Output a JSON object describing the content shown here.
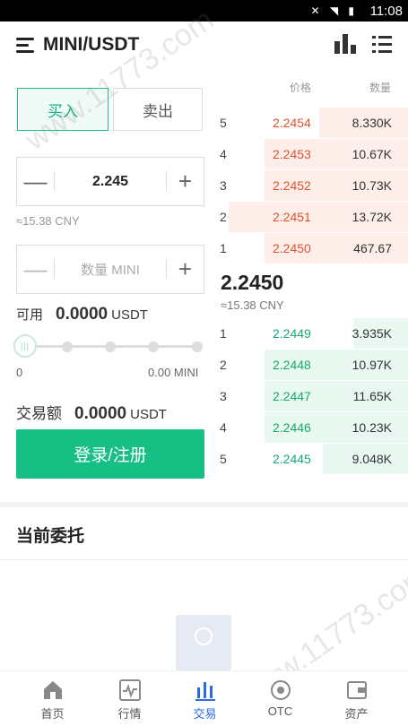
{
  "status_bar": {
    "time": "11:08",
    "icons": "✕ ◥ ▮"
  },
  "header": {
    "title": "MINI/USDT",
    "menu_icon": "menu-icon",
    "chart_icon": "bar-chart-icon",
    "list_icon": "list-icon"
  },
  "trade": {
    "tab_buy": "买入",
    "tab_sell": "卖出",
    "price_value": "2.245",
    "price_cny": "≈15.38 CNY",
    "qty_placeholder": "数量 MINI",
    "minus": "—",
    "plus": "+",
    "available_label": "可用",
    "available_value": "0.0000",
    "available_unit": "USDT",
    "slider_handle": "|||",
    "slider_min": "0",
    "slider_max": "0.00 MINI",
    "slider_level": 0,
    "amount_label": "交易额",
    "amount_value": "0.0000",
    "amount_unit": "USDT",
    "login_button": "登录/注册"
  },
  "orderbook": {
    "header_price": "价格",
    "header_qty": "数量",
    "asks": [
      {
        "idx": "5",
        "price": "2.2454",
        "qty": "8.330K",
        "depth": 0.47
      },
      {
        "idx": "4",
        "price": "2.2453",
        "qty": "10.67K",
        "depth": 0.76
      },
      {
        "idx": "3",
        "price": "2.2452",
        "qty": "10.73K",
        "depth": 0.76
      },
      {
        "idx": "2",
        "price": "2.2451",
        "qty": "13.72K",
        "depth": 0.95
      },
      {
        "idx": "1",
        "price": "2.2450",
        "qty": "467.67",
        "depth": 0.76
      }
    ],
    "last_price": "2.2450",
    "last_cny": "≈15.38 CNY",
    "bids": [
      {
        "idx": "1",
        "price": "2.2449",
        "qty": "3.935K",
        "depth": 0.29
      },
      {
        "idx": "2",
        "price": "2.2448",
        "qty": "10.97K",
        "depth": 0.76
      },
      {
        "idx": "3",
        "price": "2.2447",
        "qty": "11.65K",
        "depth": 0.76
      },
      {
        "idx": "4",
        "price": "2.2446",
        "qty": "10.23K",
        "depth": 0.76
      },
      {
        "idx": "5",
        "price": "2.2445",
        "qty": "9.048K",
        "depth": 0.45
      }
    ]
  },
  "orders": {
    "title": "当前委托"
  },
  "watermark": "www.11773.com",
  "tabs": [
    {
      "label": "首页",
      "icon": "home-icon",
      "active": false
    },
    {
      "label": "行情",
      "icon": "market-chart-icon",
      "active": false
    },
    {
      "label": "交易",
      "icon": "trade-bars-icon",
      "active": true
    },
    {
      "label": "OTC",
      "icon": "otc-icon",
      "active": false
    },
    {
      "label": "资产",
      "icon": "wallet-icon",
      "active": false
    }
  ],
  "colors": {
    "accent_green": "#17bf84",
    "ask_red": "#e0532f",
    "bid_green": "#17a974",
    "active_tab": "#2b6de0"
  }
}
